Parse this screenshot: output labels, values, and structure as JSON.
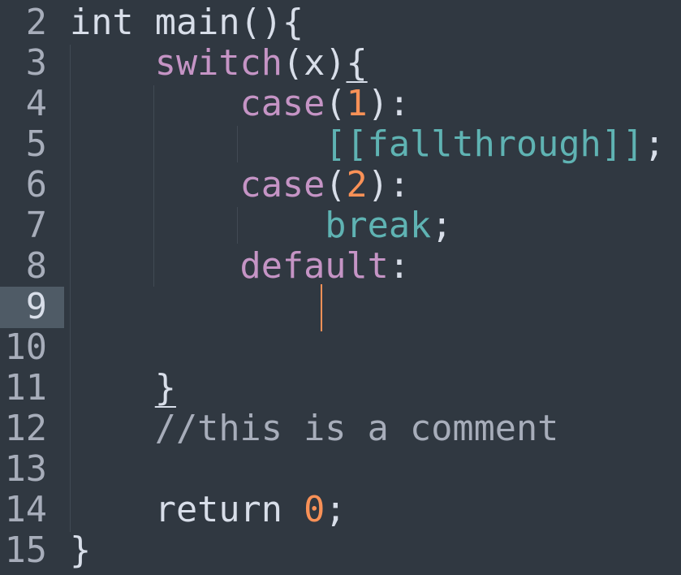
{
  "editor": {
    "active_line": "9",
    "line_numbers": [
      "2",
      "3",
      "4",
      "5",
      "6",
      "7",
      "8",
      "9",
      "10",
      "11",
      "12",
      "13",
      "14",
      "15"
    ],
    "tokens": {
      "l2_int": "int",
      "l2_main": " main(){",
      "l3_switch": "switch",
      "l3_paren": "(x)",
      "l3_brace": "{",
      "l4_case": "case",
      "l4_open": "(",
      "l4_num": "1",
      "l4_close": "):",
      "l5_attr": "[[fallthrough]]",
      "l5_semi": ";",
      "l6_case": "case",
      "l6_open": "(",
      "l6_num": "2",
      "l6_close": "):",
      "l7_break": "break",
      "l7_semi": ";",
      "l8_default": "default",
      "l8_colon": ":",
      "l11_brace": "}",
      "l12_comment": "//this is a comment",
      "l14_return": "return ",
      "l14_num": "0",
      "l14_semi": ";",
      "l15_brace": "}"
    }
  },
  "theme": {
    "background": "#303841",
    "foreground": "#d8dee9",
    "keyword_pink": "#c594c5",
    "number_orange": "#f99157",
    "teal": "#5fb3b3",
    "comment_gray": "#a7adba",
    "line_highlight": "#4f5b66"
  }
}
